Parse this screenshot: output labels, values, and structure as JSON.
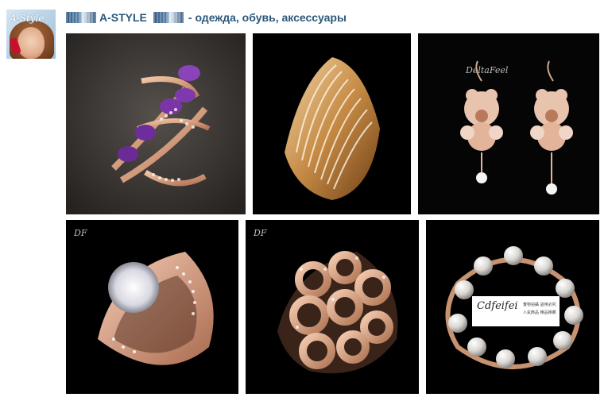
{
  "avatar": {
    "watermark": "A-Style"
  },
  "post": {
    "brand": "A-STYLE",
    "tagline": " - одежда, обувь, аксессуары"
  },
  "photos": [
    {
      "name": "amethyst-ring-photo"
    },
    {
      "name": "gold-crystal-ring-photo",
      "watermark": ""
    },
    {
      "name": "bear-earrings-photo",
      "watermark": "DeltaFeel"
    },
    {
      "name": "solitaire-ring-photo",
      "watermark": "DF"
    },
    {
      "name": "circles-ring-photo",
      "watermark": "DF"
    },
    {
      "name": "pearl-bracelet-photo",
      "logo": "Cdfeifei",
      "logo_sub": "實物拍攝 盜用必究",
      "logo_sub2": "人氣飾品 精品推薦"
    }
  ],
  "colors": {
    "link": "#2b587a",
    "flag": "#35597f"
  }
}
